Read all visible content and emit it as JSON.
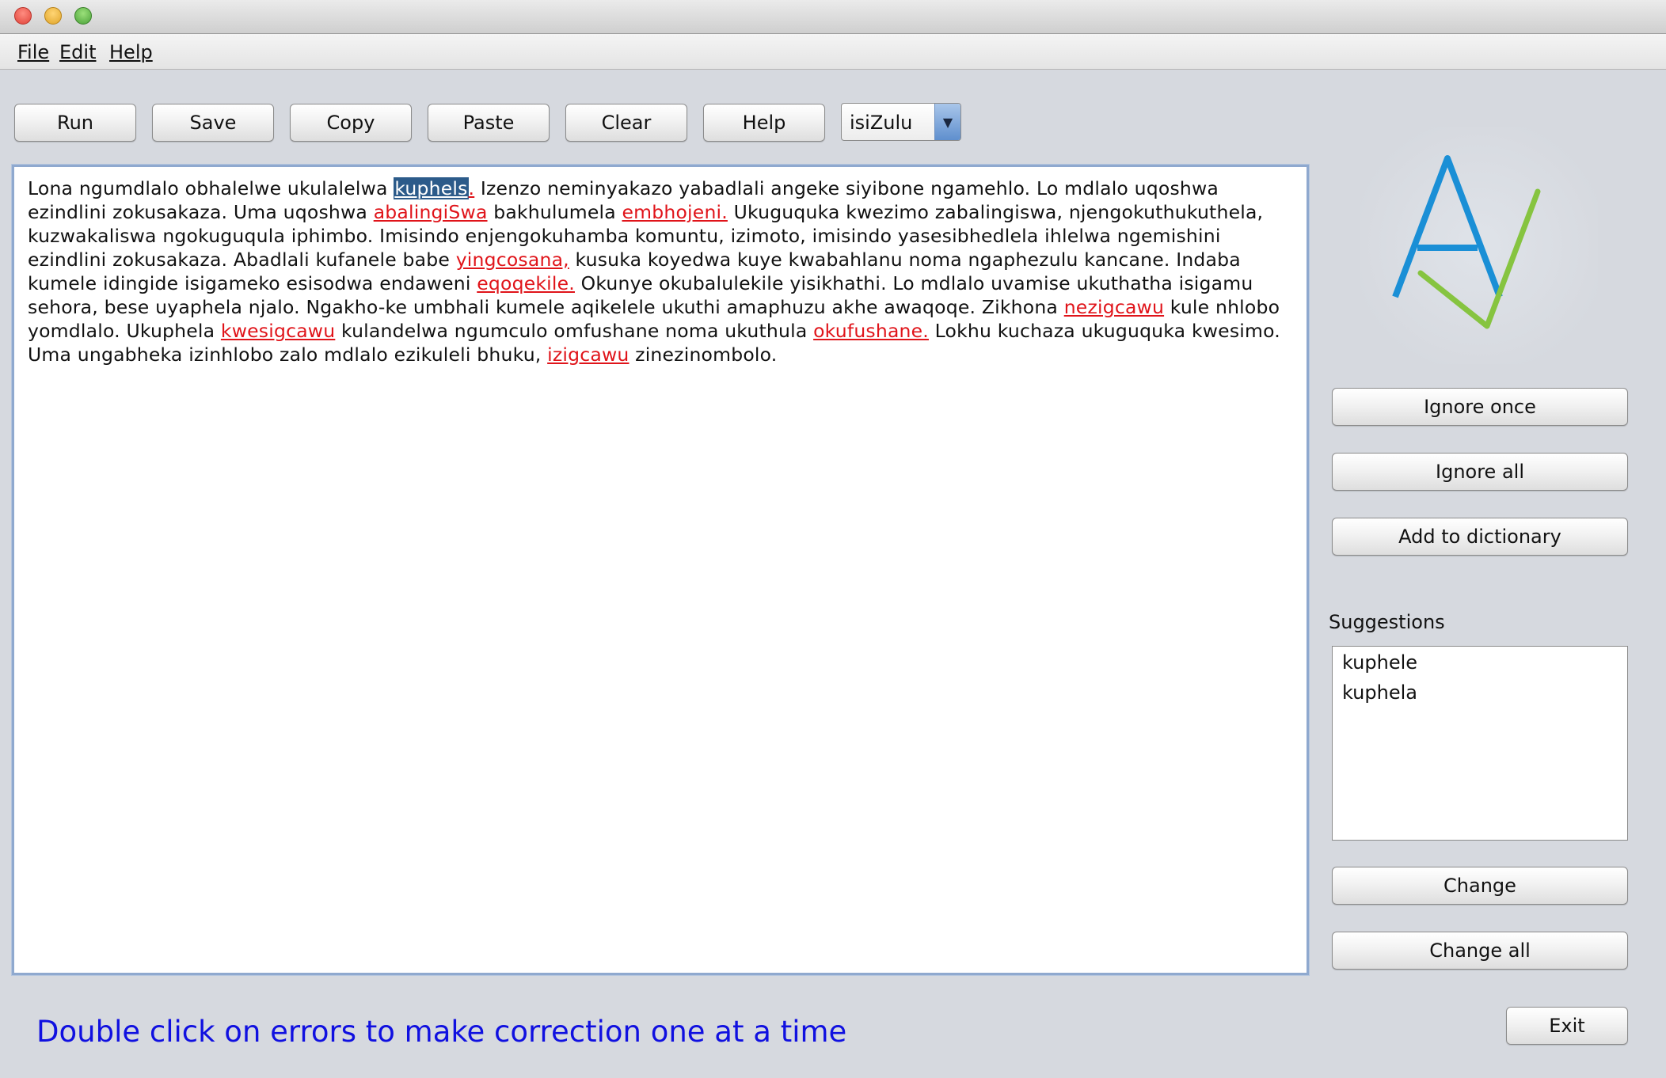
{
  "window": {
    "title": ""
  },
  "menubar": {
    "items": [
      "File",
      "Edit",
      "Help"
    ]
  },
  "toolbar": {
    "run": "Run",
    "save": "Save",
    "copy": "Copy",
    "paste": "Paste",
    "clear": "Clear",
    "help": "Help",
    "language": "isiZulu"
  },
  "editor": {
    "segments": [
      {
        "text": "Lona ngumdlalo obhalelwe ukulalelwa ",
        "type": "normal"
      },
      {
        "text": "kuphels",
        "type": "selected"
      },
      {
        "text": ".",
        "type": "error"
      },
      {
        "text": " Izenzo neminyakazo yabadlali angeke siyibone ngamehlo. Lo mdlalo uqoshwa ezindlini zokusakaza. Uma uqoshwa ",
        "type": "normal"
      },
      {
        "text": "abalingiSwa",
        "type": "error"
      },
      {
        "text": " bakhulumela ",
        "type": "normal"
      },
      {
        "text": "embhojeni.",
        "type": "error"
      },
      {
        "text": " Ukuguquka kwezimo zabalingiswa, njengokuthukuthela, kuzwakaliswa ngokuguqula iphimbo. Imisindo enjengokuhamba komuntu, izimoto, imisindo yasesibhedlela ihlelwa ngemishini ezindlini zokusakaza. Abadlali kufanele babe ",
        "type": "normal"
      },
      {
        "text": "yingcosana,",
        "type": "error"
      },
      {
        "text": " kusuka koyedwa kuye kwabahlanu noma ngaphezulu kancane. Indaba kumele idingide isigameko esisodwa endaweni ",
        "type": "normal"
      },
      {
        "text": "eqoqekile.",
        "type": "error"
      },
      {
        "text": " Okunye okubalulekile yisikhathi. Lo mdlalo uvamise ukuthatha isigamu sehora, bese uyaphela njalo. Ngakho-ke umbhali kumele aqikelele ukuthi amaphuzu akhe awaqoqe. Zikhona ",
        "type": "normal"
      },
      {
        "text": "nezigcawu",
        "type": "error"
      },
      {
        "text": " kule nhlobo yomdlalo. Ukuphela ",
        "type": "normal"
      },
      {
        "text": "kwesigcawu",
        "type": "error"
      },
      {
        "text": " kulandelwa ngumculo omfushane noma ukuthula ",
        "type": "normal"
      },
      {
        "text": "okufushane.",
        "type": "error"
      },
      {
        "text": " Lokhu kuchaza ukuguquka kwesimo. Uma ungabheka izinhlobo zalo mdlalo ezikuleli bhuku, ",
        "type": "normal"
      },
      {
        "text": "izigcawu",
        "type": "error"
      },
      {
        "text": " zinezinombolo.",
        "type": "normal"
      }
    ]
  },
  "sidebar": {
    "logo_icon": "av-checkmark-logo",
    "colors": {
      "logo_a": "#1a8fd6",
      "logo_check": "#86c440"
    },
    "ignore_once": "Ignore once",
    "ignore_all": "Ignore all",
    "add_to_dictionary": "Add to dictionary",
    "suggestions_label": "Suggestions",
    "suggestions": [
      "kuphele",
      "kuphela"
    ],
    "change": "Change",
    "change_all": "Change all",
    "exit": "Exit"
  },
  "footer": {
    "hint": "Double click on errors to make correction one at a time"
  },
  "colors": {
    "error": "#e0141a",
    "selection": "#2c5b8a",
    "hint": "#1010e0",
    "editor_border": "#8fa9cf"
  }
}
